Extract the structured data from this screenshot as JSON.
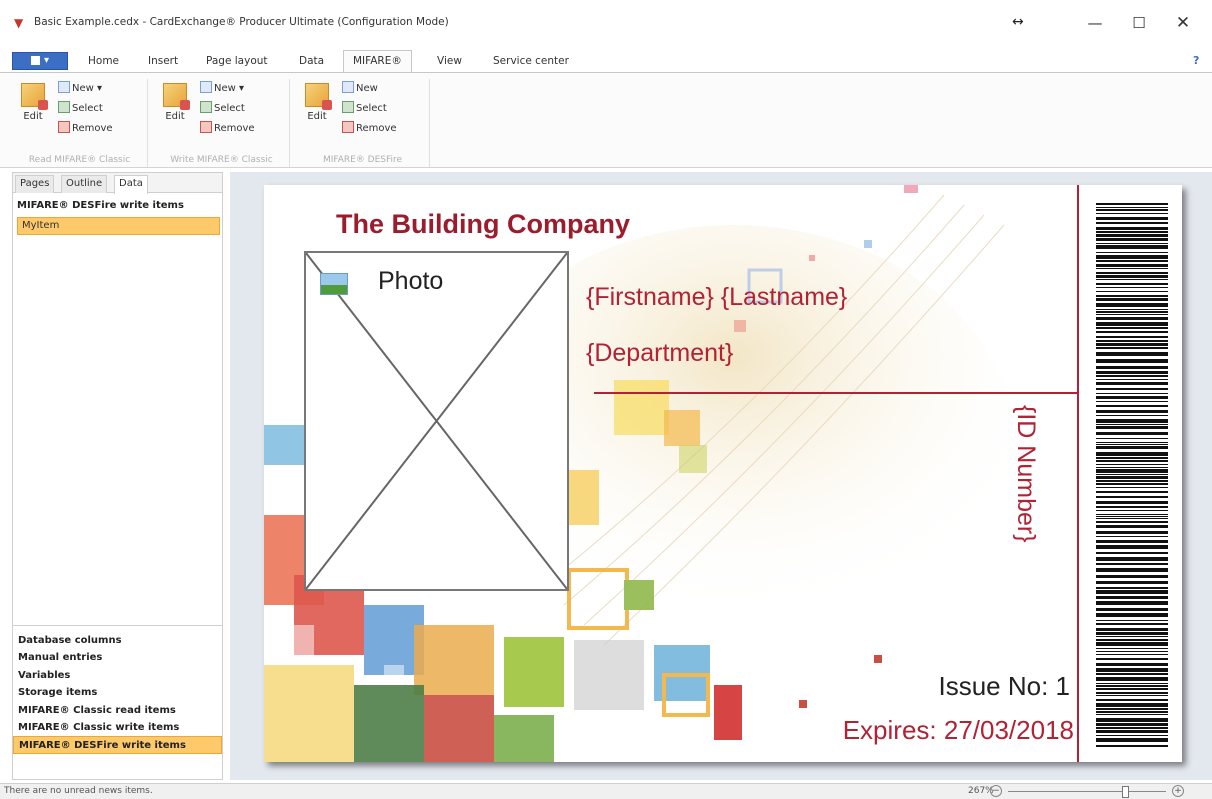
{
  "window": {
    "title": "Basic Example.cedx - CardExchange® Producer Ultimate (Configuration Mode)",
    "controls": {
      "resize": "↔",
      "minimize": "—",
      "maximize": "☐",
      "close": "✕"
    }
  },
  "ribbon": {
    "tabs": [
      "Home",
      "Insert",
      "Page layout",
      "Data",
      "MIFARE®",
      "View",
      "Service center"
    ],
    "active_tab": "MIFARE®",
    "help": "?",
    "groups": [
      {
        "edit": "Edit",
        "new": "New",
        "select": "Select",
        "remove": "Remove",
        "label": "Read MIFARE® Classic"
      },
      {
        "edit": "Edit",
        "new": "New",
        "select": "Select",
        "remove": "Remove",
        "label": "Write MIFARE® Classic"
      },
      {
        "edit": "Edit",
        "new": "New",
        "select": "Select",
        "remove": "Remove",
        "label": "MIFARE® DESFire"
      }
    ]
  },
  "left_panel": {
    "tabs": [
      "Pages",
      "Outline",
      "Data"
    ],
    "active_tab": "Data",
    "heading": "MIFARE® DESFire write items",
    "selected_item": "MyItem",
    "categories": [
      "Database columns",
      "Manual entries",
      "Variables",
      "Storage items",
      "MIFARE® Classic read items",
      "MIFARE® Classic write items",
      "MIFARE® DESFire write items"
    ],
    "active_category": "MIFARE® DESFire write items"
  },
  "card": {
    "company": "The Building Company",
    "photo_label": "Photo",
    "name": "{Firstname} {Lastname}",
    "department": "{Department}",
    "id_number": "{ID Number}",
    "issue": "Issue No: 1",
    "expires": "Expires: 27/03/2018",
    "accent_color": "#b22234"
  },
  "status_bar": {
    "message": "There are no unread news items.",
    "zoom": "267%",
    "zoom_level_fraction": 0.74
  }
}
